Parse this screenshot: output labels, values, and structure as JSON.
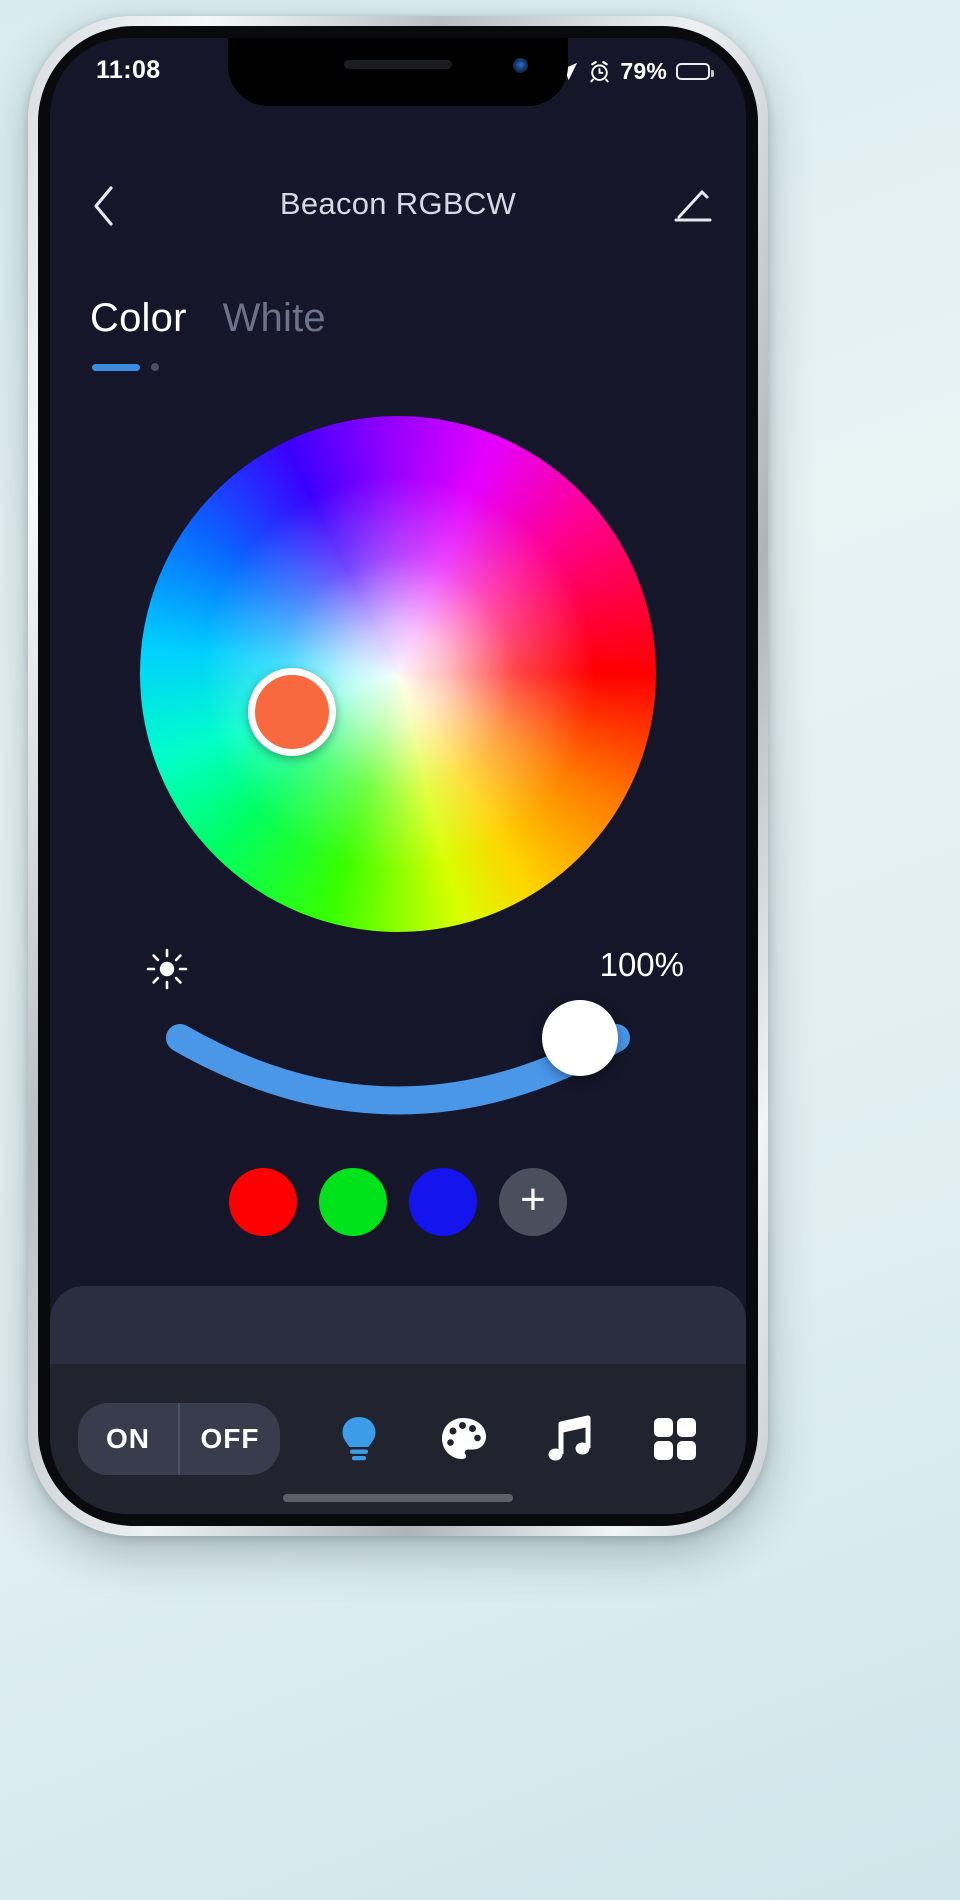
{
  "status_bar": {
    "time": "11:08",
    "battery_percent": "79%",
    "battery_level": 79,
    "icons": [
      "rotation-lock-icon",
      "location-arrow-icon",
      "alarm-clock-icon",
      "battery-icon"
    ]
  },
  "header": {
    "title": "Beacon RGBCW",
    "back_icon": "chevron-left-icon",
    "edit_icon": "pencil-edit-icon"
  },
  "tabs": [
    {
      "label": "Color",
      "active": true
    },
    {
      "label": "White",
      "active": false
    }
  ],
  "color_picker": {
    "selected_color": "#f8693f",
    "knob_ring_color": "#ffffff",
    "wheel_name": "hsv-color-wheel"
  },
  "brightness": {
    "icon": "brightness-sun-icon",
    "value_label": "100%",
    "value": 100,
    "track_color": "#4a97e8",
    "knob_color": "#ffffff"
  },
  "presets": [
    {
      "name": "preset-red",
      "color": "#ff0000"
    },
    {
      "name": "preset-green",
      "color": "#00e21a"
    },
    {
      "name": "preset-blue",
      "color": "#1414ee"
    },
    {
      "name": "preset-add",
      "color": "#4a4e5d",
      "label": "+"
    }
  ],
  "bottom_bar": {
    "on_label": "ON",
    "off_label": "OFF",
    "nav_items": [
      {
        "name": "bulb-icon",
        "active": true,
        "color": "#3d9ce8"
      },
      {
        "name": "palette-icon",
        "active": false,
        "color": "#ffffff"
      },
      {
        "name": "music-note-icon",
        "active": false,
        "color": "#ffffff"
      },
      {
        "name": "grid-apps-icon",
        "active": false,
        "color": "#ffffff"
      }
    ]
  },
  "theme": {
    "screen_bg": "#15162a",
    "panel_bg": "#2b2e3f",
    "bar_bg": "#21232f",
    "accent": "#3d8bdd"
  }
}
